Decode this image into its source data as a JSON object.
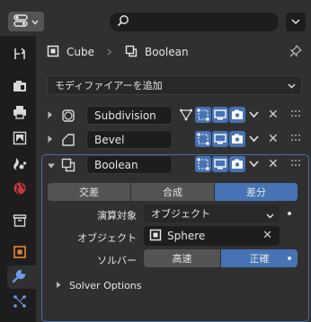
{
  "header": {
    "editor_type_icon": "properties-editor-icon",
    "search_placeholder": ""
  },
  "tabs": [
    {
      "name": "tool",
      "icon": "tool-icon"
    },
    {
      "name": "render",
      "icon": "camera-back-icon"
    },
    {
      "name": "output",
      "icon": "printer-icon"
    },
    {
      "name": "view-layer",
      "icon": "image-icon"
    },
    {
      "name": "scene",
      "icon": "scene-icon"
    },
    {
      "name": "world",
      "icon": "world-icon"
    },
    {
      "name": "collection",
      "icon": "collection-icon"
    },
    {
      "name": "object",
      "icon": "object-icon"
    },
    {
      "name": "modifiers",
      "icon": "wrench-icon",
      "active": true
    },
    {
      "name": "particles",
      "icon": "particles-icon"
    }
  ],
  "breadcrumb": {
    "object": "Cube",
    "modifier": "Boolean"
  },
  "add_modifier_label": "モディファイアーを追加",
  "modifiers": [
    {
      "name": "Subdivision",
      "expanded": false
    },
    {
      "name": "Bevel",
      "expanded": false
    },
    {
      "name": "Boolean",
      "expanded": true
    }
  ],
  "boolean": {
    "operations": [
      "交差",
      "合成",
      "差分"
    ],
    "active_operation": "差分",
    "operand_label": "演算対象",
    "operand_value": "オブジェクト",
    "object_label": "オブジェクト",
    "object_value": "Sphere",
    "solver_label": "ソルバー",
    "solver_options": [
      "高速",
      "正確"
    ],
    "active_solver": "正確",
    "subpanel_label": "Solver Options"
  },
  "colors": {
    "accent": "#4772b3",
    "panel_bg": "#303030",
    "window_bg": "#1d1d1d"
  }
}
